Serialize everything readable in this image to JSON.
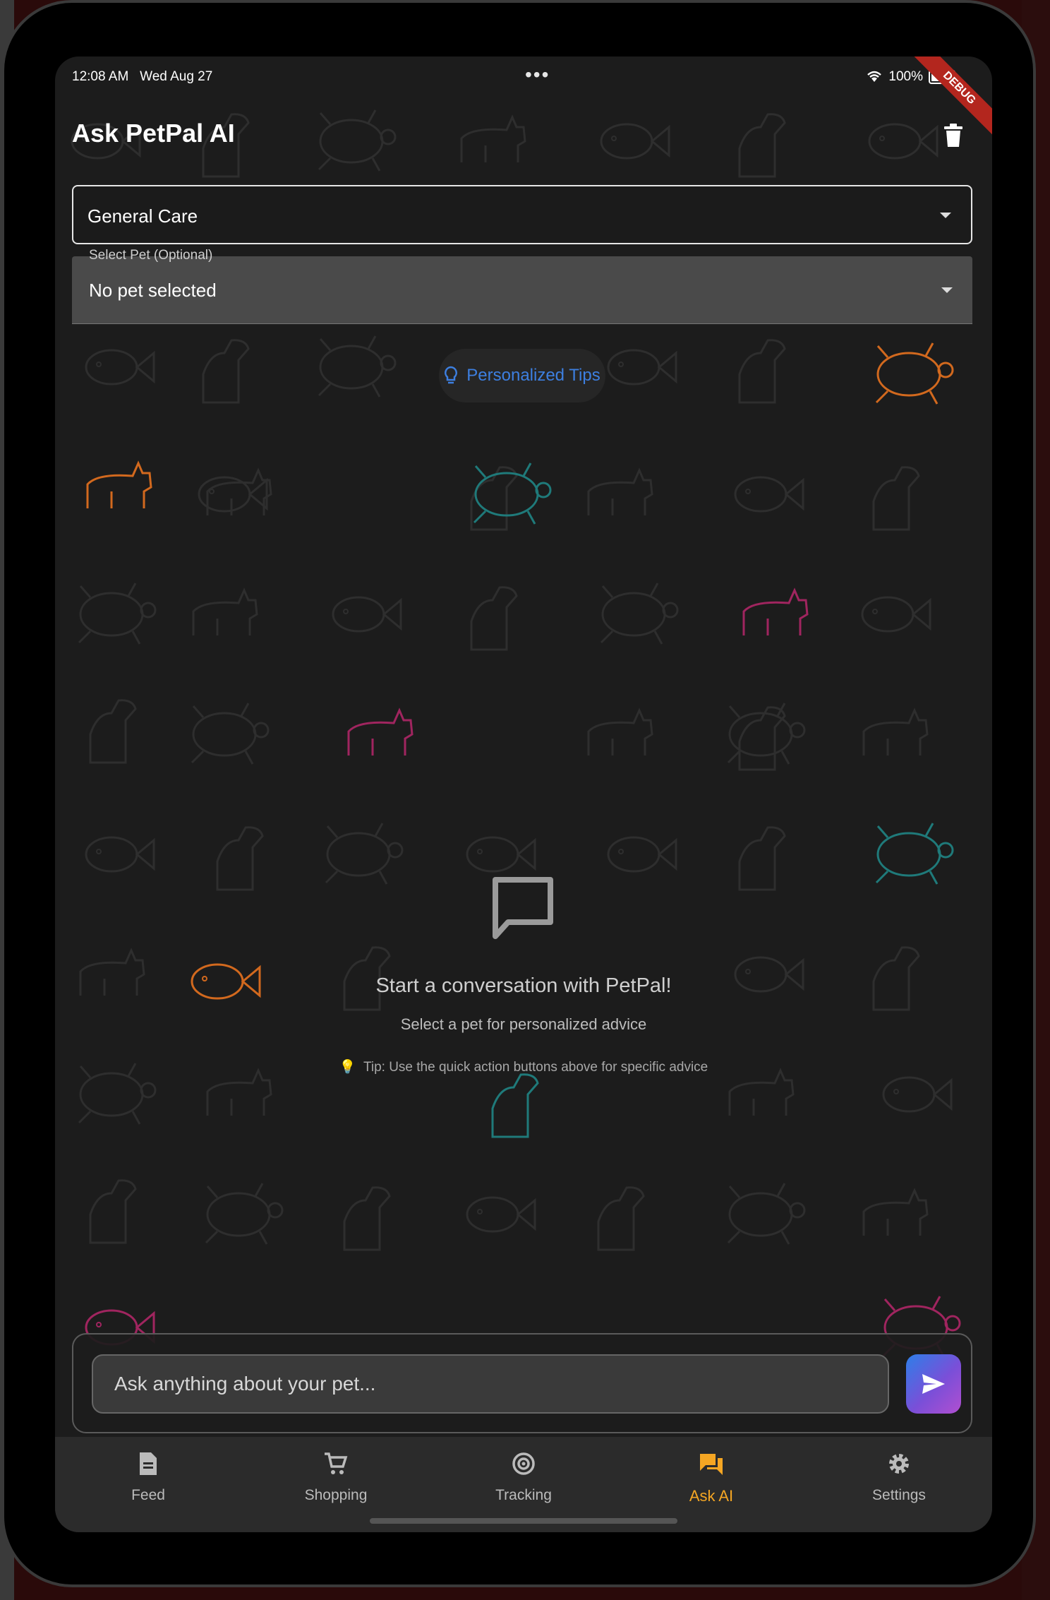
{
  "status_bar": {
    "time": "12:08 AM",
    "date": "Wed Aug 27",
    "dots": "•••",
    "battery": "100%"
  },
  "debug_banner": "DEBUG",
  "header": {
    "title": "Ask PetPal AI"
  },
  "category_dropdown": {
    "value": "General Care"
  },
  "pet_dropdown": {
    "label": "Select Pet (Optional)",
    "value": "No pet selected"
  },
  "tips_chip": {
    "label": "Personalized Tips"
  },
  "empty_state": {
    "title": "Start a conversation with PetPal!",
    "subtitle": "Select a pet for personalized advice",
    "tip_icon": "💡",
    "tip": "Tip: Use the quick action buttons above for specific advice"
  },
  "composer": {
    "placeholder": "Ask anything about your pet..."
  },
  "tabs": [
    {
      "label": "Feed",
      "icon": "feed-icon"
    },
    {
      "label": "Shopping",
      "icon": "cart-icon"
    },
    {
      "label": "Tracking",
      "icon": "tracking-icon"
    },
    {
      "label": "Ask AI",
      "icon": "chat-icon"
    },
    {
      "label": "Settings",
      "icon": "gear-icon"
    }
  ],
  "colors": {
    "accent_active": "#f5a623",
    "link_blue": "#3d7fe0",
    "background": "#1c1c1c"
  }
}
